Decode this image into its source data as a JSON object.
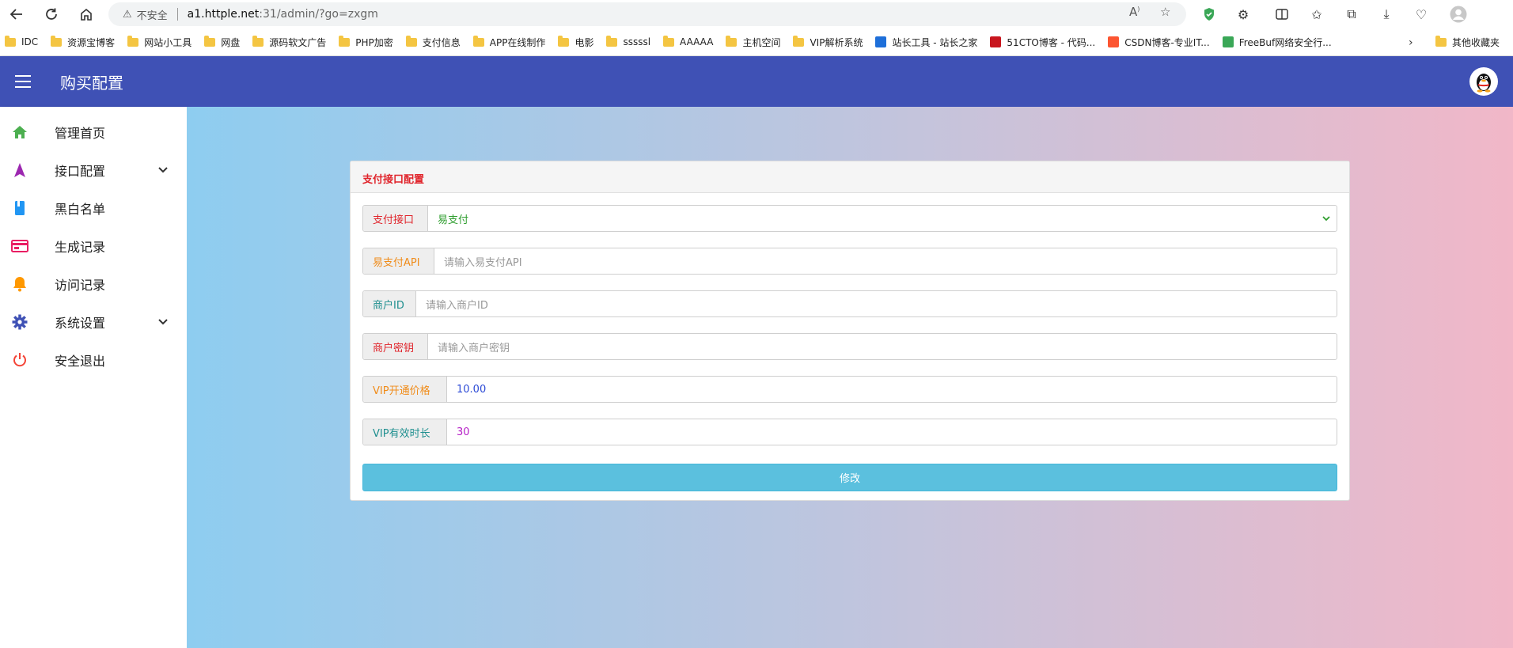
{
  "browser": {
    "security_label": "不安全",
    "url_host": "a1.httple.net",
    "url_path": ":31/admin/?go=zxgm"
  },
  "bookmarks": [
    {
      "label": "IDC",
      "type": "folder"
    },
    {
      "label": "资源宝博客",
      "type": "folder"
    },
    {
      "label": "网站小工具",
      "type": "folder"
    },
    {
      "label": "网盘",
      "type": "folder"
    },
    {
      "label": "源码软文广告",
      "type": "folder"
    },
    {
      "label": "PHP加密",
      "type": "folder"
    },
    {
      "label": "支付信息",
      "type": "folder"
    },
    {
      "label": "APP在线制作",
      "type": "folder"
    },
    {
      "label": "电影",
      "type": "folder"
    },
    {
      "label": "sssssl",
      "type": "folder"
    },
    {
      "label": "AAAAA",
      "type": "folder"
    },
    {
      "label": "主机空间",
      "type": "folder"
    },
    {
      "label": "VIP解析系统",
      "type": "folder"
    },
    {
      "label": "站长工具 - 站长之家",
      "type": "site",
      "color": "#1e6fd9"
    },
    {
      "label": "51CTO博客 - 代码...",
      "type": "site",
      "color": "#c8161e"
    },
    {
      "label": "CSDN博客-专业IT...",
      "type": "site",
      "color": "#fc5531"
    },
    {
      "label": "FreeBuf网络安全行...",
      "type": "site",
      "color": "#3aa757"
    }
  ],
  "bookmarks_other": "其他收藏夹",
  "header": {
    "title": "购买配置"
  },
  "sidebar": {
    "items": [
      {
        "label": "管理首页",
        "icon": "home-icon",
        "color": "#4caf50"
      },
      {
        "label": "接口配置",
        "icon": "navigation-icon",
        "color": "#9c27b0",
        "expandable": true
      },
      {
        "label": "黑白名单",
        "icon": "book-icon",
        "color": "#2196f3"
      },
      {
        "label": "生成记录",
        "icon": "card-icon",
        "color": "#e91e63"
      },
      {
        "label": "访问记录",
        "icon": "bell-icon",
        "color": "#ff9800"
      },
      {
        "label": "系统设置",
        "icon": "gear-icon",
        "color": "#3f51b5",
        "expandable": true
      },
      {
        "label": "安全退出",
        "icon": "power-icon",
        "color": "#f44336"
      }
    ]
  },
  "form": {
    "title": "支付接口配置",
    "payment_interface": {
      "label": "支付接口",
      "value": "易支付",
      "label_color": "#e0242b"
    },
    "epay_api": {
      "label": "易支付API",
      "placeholder": "请输入易支付API",
      "label_color": "#f08c1a"
    },
    "merchant_id": {
      "label": "商户ID",
      "placeholder": "请输入商户ID",
      "label_color": "#1f8f8f"
    },
    "merchant_key": {
      "label": "商户密钥",
      "placeholder": "请输入商户密钥",
      "label_color": "#e0242b"
    },
    "vip_price": {
      "label": "VIP开通价格",
      "value": "10.00",
      "label_color": "#f08c1a"
    },
    "vip_duration": {
      "label": "VIP有效时长",
      "value": "30",
      "label_color": "#1f8f8f"
    },
    "submit_label": "修改"
  }
}
